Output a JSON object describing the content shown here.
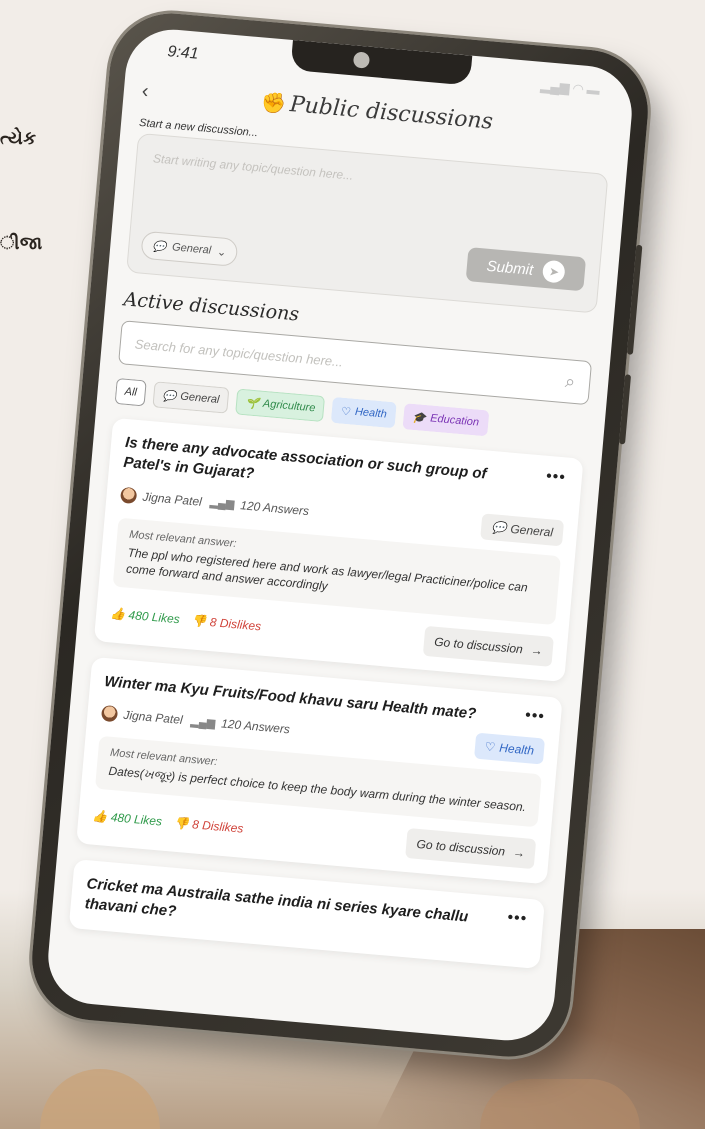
{
  "side_text": [
    "ત્યેક",
    "ીજા"
  ],
  "status": {
    "time": "9:41"
  },
  "header": {
    "title": "Public discussions",
    "back_icon": "chevron-left-icon"
  },
  "composer": {
    "label": "Start a new discussion...",
    "placeholder": "Start writing any topic/question here...",
    "category": "General",
    "submit_label": "Submit"
  },
  "active": {
    "title": "Active discussions",
    "search_placeholder": "Search for any topic/question here..."
  },
  "filters": [
    {
      "label": "All",
      "icon": "",
      "kind": "all"
    },
    {
      "label": "General",
      "icon": "speech-bubble-icon",
      "kind": "general"
    },
    {
      "label": "Agriculture",
      "icon": "plant-icon",
      "kind": "agri"
    },
    {
      "label": "Health",
      "icon": "heartbeat-icon",
      "kind": "health"
    },
    {
      "label": "Education",
      "icon": "graduation-cap-icon",
      "kind": "edu"
    }
  ],
  "discussions": [
    {
      "question": "Is there any advocate association or such group of Patel's in Gujarat?",
      "author": "Jigna Patel",
      "answers": "120 Answers",
      "tag": "General",
      "answer_label": "Most relevant answer:",
      "answer": "The ppl who registered here and work as lawyer/legal Practiciner/police can come forward and answer accordingly",
      "likes": "480 Likes",
      "dislikes": "8 Dislikes",
      "go": "Go to discussion"
    },
    {
      "question": "Winter ma Kyu Fruits/Food khavu saru Health mate?",
      "author": "Jigna Patel",
      "answers": "120 Answers",
      "tag": "Health",
      "answer_label": "Most relevant answer:",
      "answer": "Dates(ખજૂર) is perfect choice to keep the body warm during the winter season.",
      "likes": "480 Likes",
      "dislikes": "8 Dislikes",
      "go": "Go to discussion"
    },
    {
      "question": "Cricket ma Austraila sathe india ni series kyare challu thavani che?"
    }
  ]
}
